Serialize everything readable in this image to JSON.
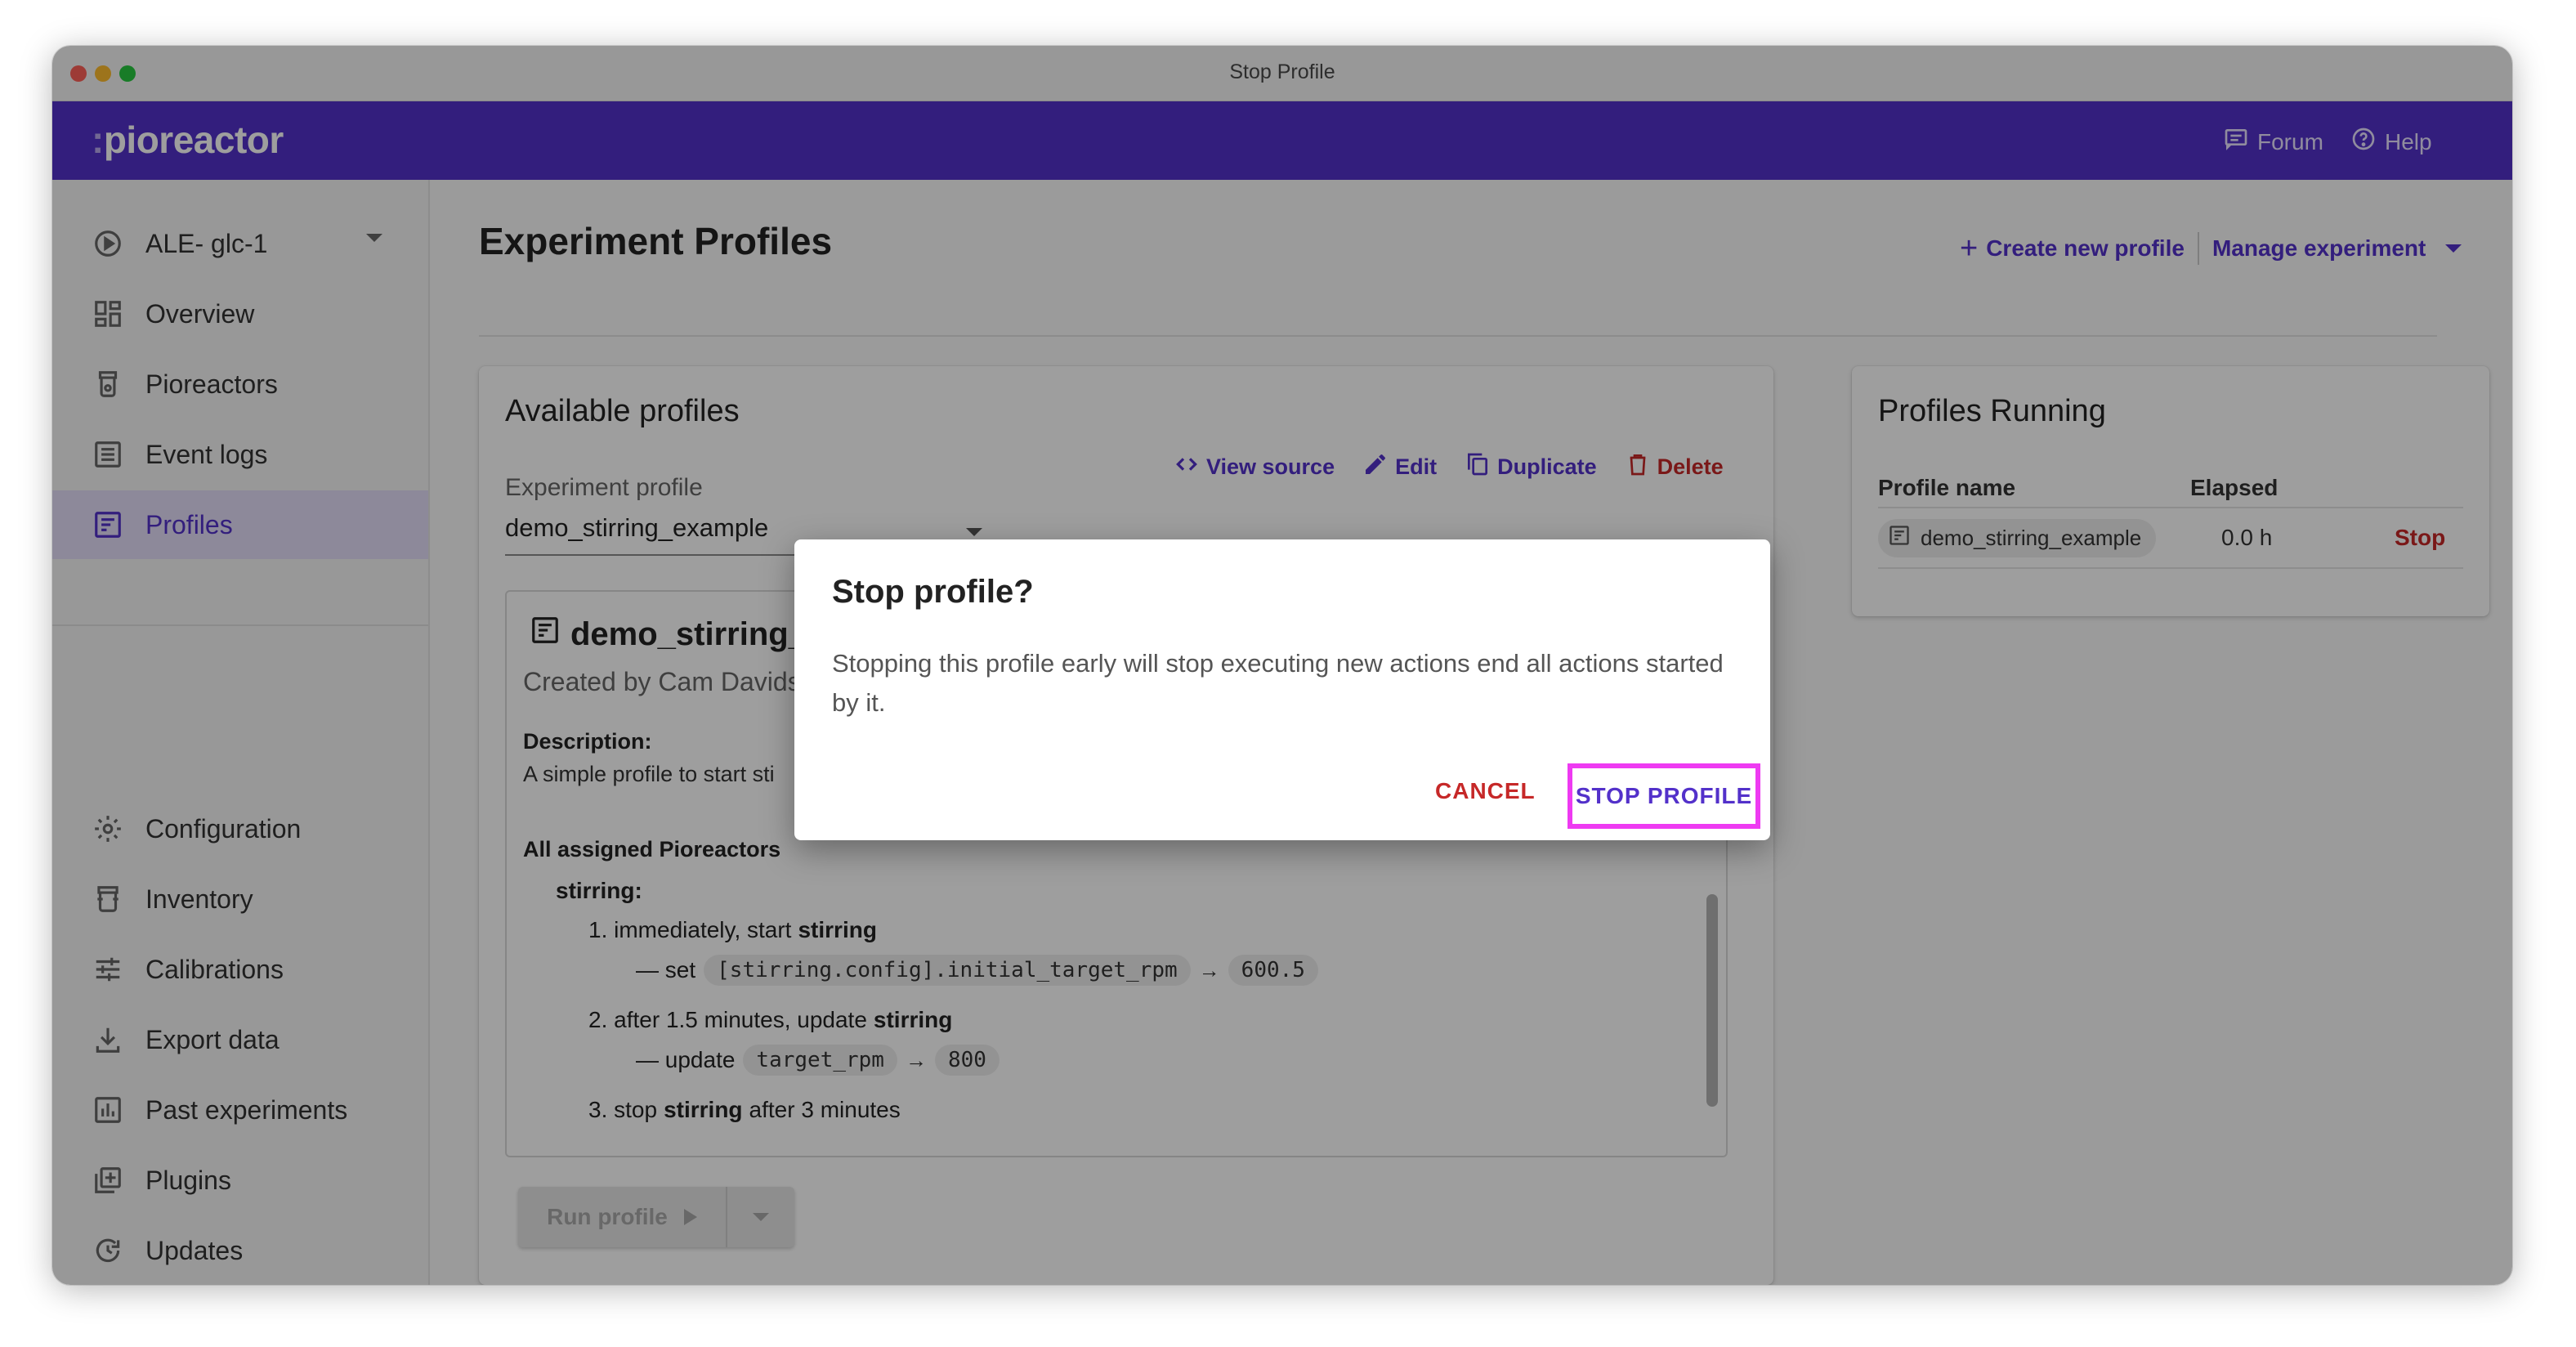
{
  "window": {
    "title": "Stop Profile"
  },
  "appbar": {
    "logo": "pioreactor",
    "forum_label": "Forum",
    "help_label": "Help"
  },
  "sidebar": {
    "experiment_selector": "ALE- glc-1",
    "items": [
      {
        "label": "Overview",
        "icon": "dashboard-icon"
      },
      {
        "label": "Pioreactors",
        "icon": "pioreactor-icon"
      },
      {
        "label": "Event logs",
        "icon": "list-icon"
      },
      {
        "label": "Profiles",
        "icon": "profile-icon",
        "active": true
      }
    ],
    "bottom_items": [
      {
        "label": "Configuration",
        "icon": "gear-icon"
      },
      {
        "label": "Inventory",
        "icon": "inventory-icon"
      },
      {
        "label": "Calibrations",
        "icon": "tune-icon"
      },
      {
        "label": "Export data",
        "icon": "download-icon"
      },
      {
        "label": "Past experiments",
        "icon": "chart-icon"
      },
      {
        "label": "Plugins",
        "icon": "plus-box-icon"
      },
      {
        "label": "Updates",
        "icon": "update-icon"
      }
    ]
  },
  "main": {
    "title": "Experiment Profiles",
    "create_label": "Create new profile",
    "manage_label": "Manage experiment"
  },
  "available": {
    "title": "Available profiles",
    "actions": {
      "view_source": "View source",
      "edit": "Edit",
      "duplicate": "Duplicate",
      "delete": "Delete"
    },
    "select_label": "Experiment profile",
    "selected_profile": "demo_stirring_example",
    "detail": {
      "name": "demo_stirring_",
      "author": "Created by Cam Davids",
      "description_label": "Description:",
      "description": "A simple profile to start sti",
      "assigned_label": "All assigned Pioreactors",
      "job": "stirring:",
      "step1": {
        "num": "1.",
        "text": "immediately, start",
        "job": "stirring"
      },
      "step1_sub": {
        "prefix": "— set",
        "param": "[stirring.config].initial_target_rpm",
        "arrow": "→",
        "value": "600.5"
      },
      "step2": {
        "num": "2.",
        "text": "after 1.5 minutes, update",
        "job": "stirring"
      },
      "step2_sub": {
        "prefix": "— update",
        "param": "target_rpm",
        "arrow": "→",
        "value": "800"
      },
      "step3": {
        "num": "3.",
        "text": "stop",
        "job": "stirring",
        "after": "after 3 minutes"
      }
    },
    "run_label": "Run profile"
  },
  "running": {
    "title": "Profiles Running",
    "col_name": "Profile name",
    "col_elapsed": "Elapsed",
    "rows": [
      {
        "name": "demo_stirring_example",
        "elapsed": "0.0 h",
        "action": "Stop"
      }
    ]
  },
  "dialog": {
    "title": "Stop profile?",
    "body": "Stopping this profile early will stop executing new actions end all actions started by it.",
    "cancel_label": "CANCEL",
    "confirm_label": "STOP PROFILE"
  },
  "colors": {
    "brand": "#5331ca",
    "danger": "#c62828",
    "highlight": "#ee3af2"
  }
}
